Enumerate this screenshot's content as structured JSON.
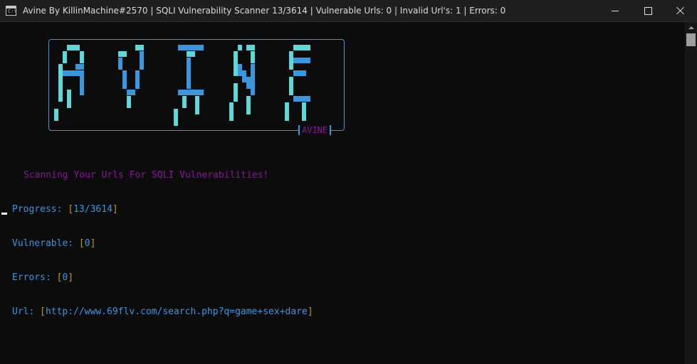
{
  "window": {
    "title": "Avine By KillinMachine#2570  |  SQLI Vulnerability Scanner 13/3614  |  Vulnerable Urls: 0  |  Invalid Url's: 1  |  Errors: 0",
    "icon": "terminal-icon",
    "icon_glyph": "C:\\",
    "controls": [
      "minimize-icon",
      "maximize-icon",
      "close-icon"
    ]
  },
  "banner": {
    "logo_text": "AVINE",
    "tag": "AVINE",
    "colors": {
      "light": "#61d6d6",
      "dark": "#3a96dd",
      "border": "#3a96dd",
      "tag": "#881798"
    }
  },
  "console": {
    "heading": "Scanning Your Urls For SQLI Vulnerabilities!",
    "progress_label": "Progress: ",
    "progress_value": "13/3614",
    "vulnerable_label": "Vulnerable: ",
    "vulnerable_value": "0",
    "errors_label": "Errors: ",
    "errors_value": "0",
    "url_label": "Url: ",
    "url_value": "http://www.69flv.com/search.php?q=game+sex+dare",
    "bracket_open": "[",
    "bracket_close": "]"
  },
  "colors": {
    "background": "#0c0c0c",
    "titlebar": "#1f1f1f",
    "magenta": "#881798",
    "blue": "#3a96dd",
    "yellow": "#c19c00"
  }
}
